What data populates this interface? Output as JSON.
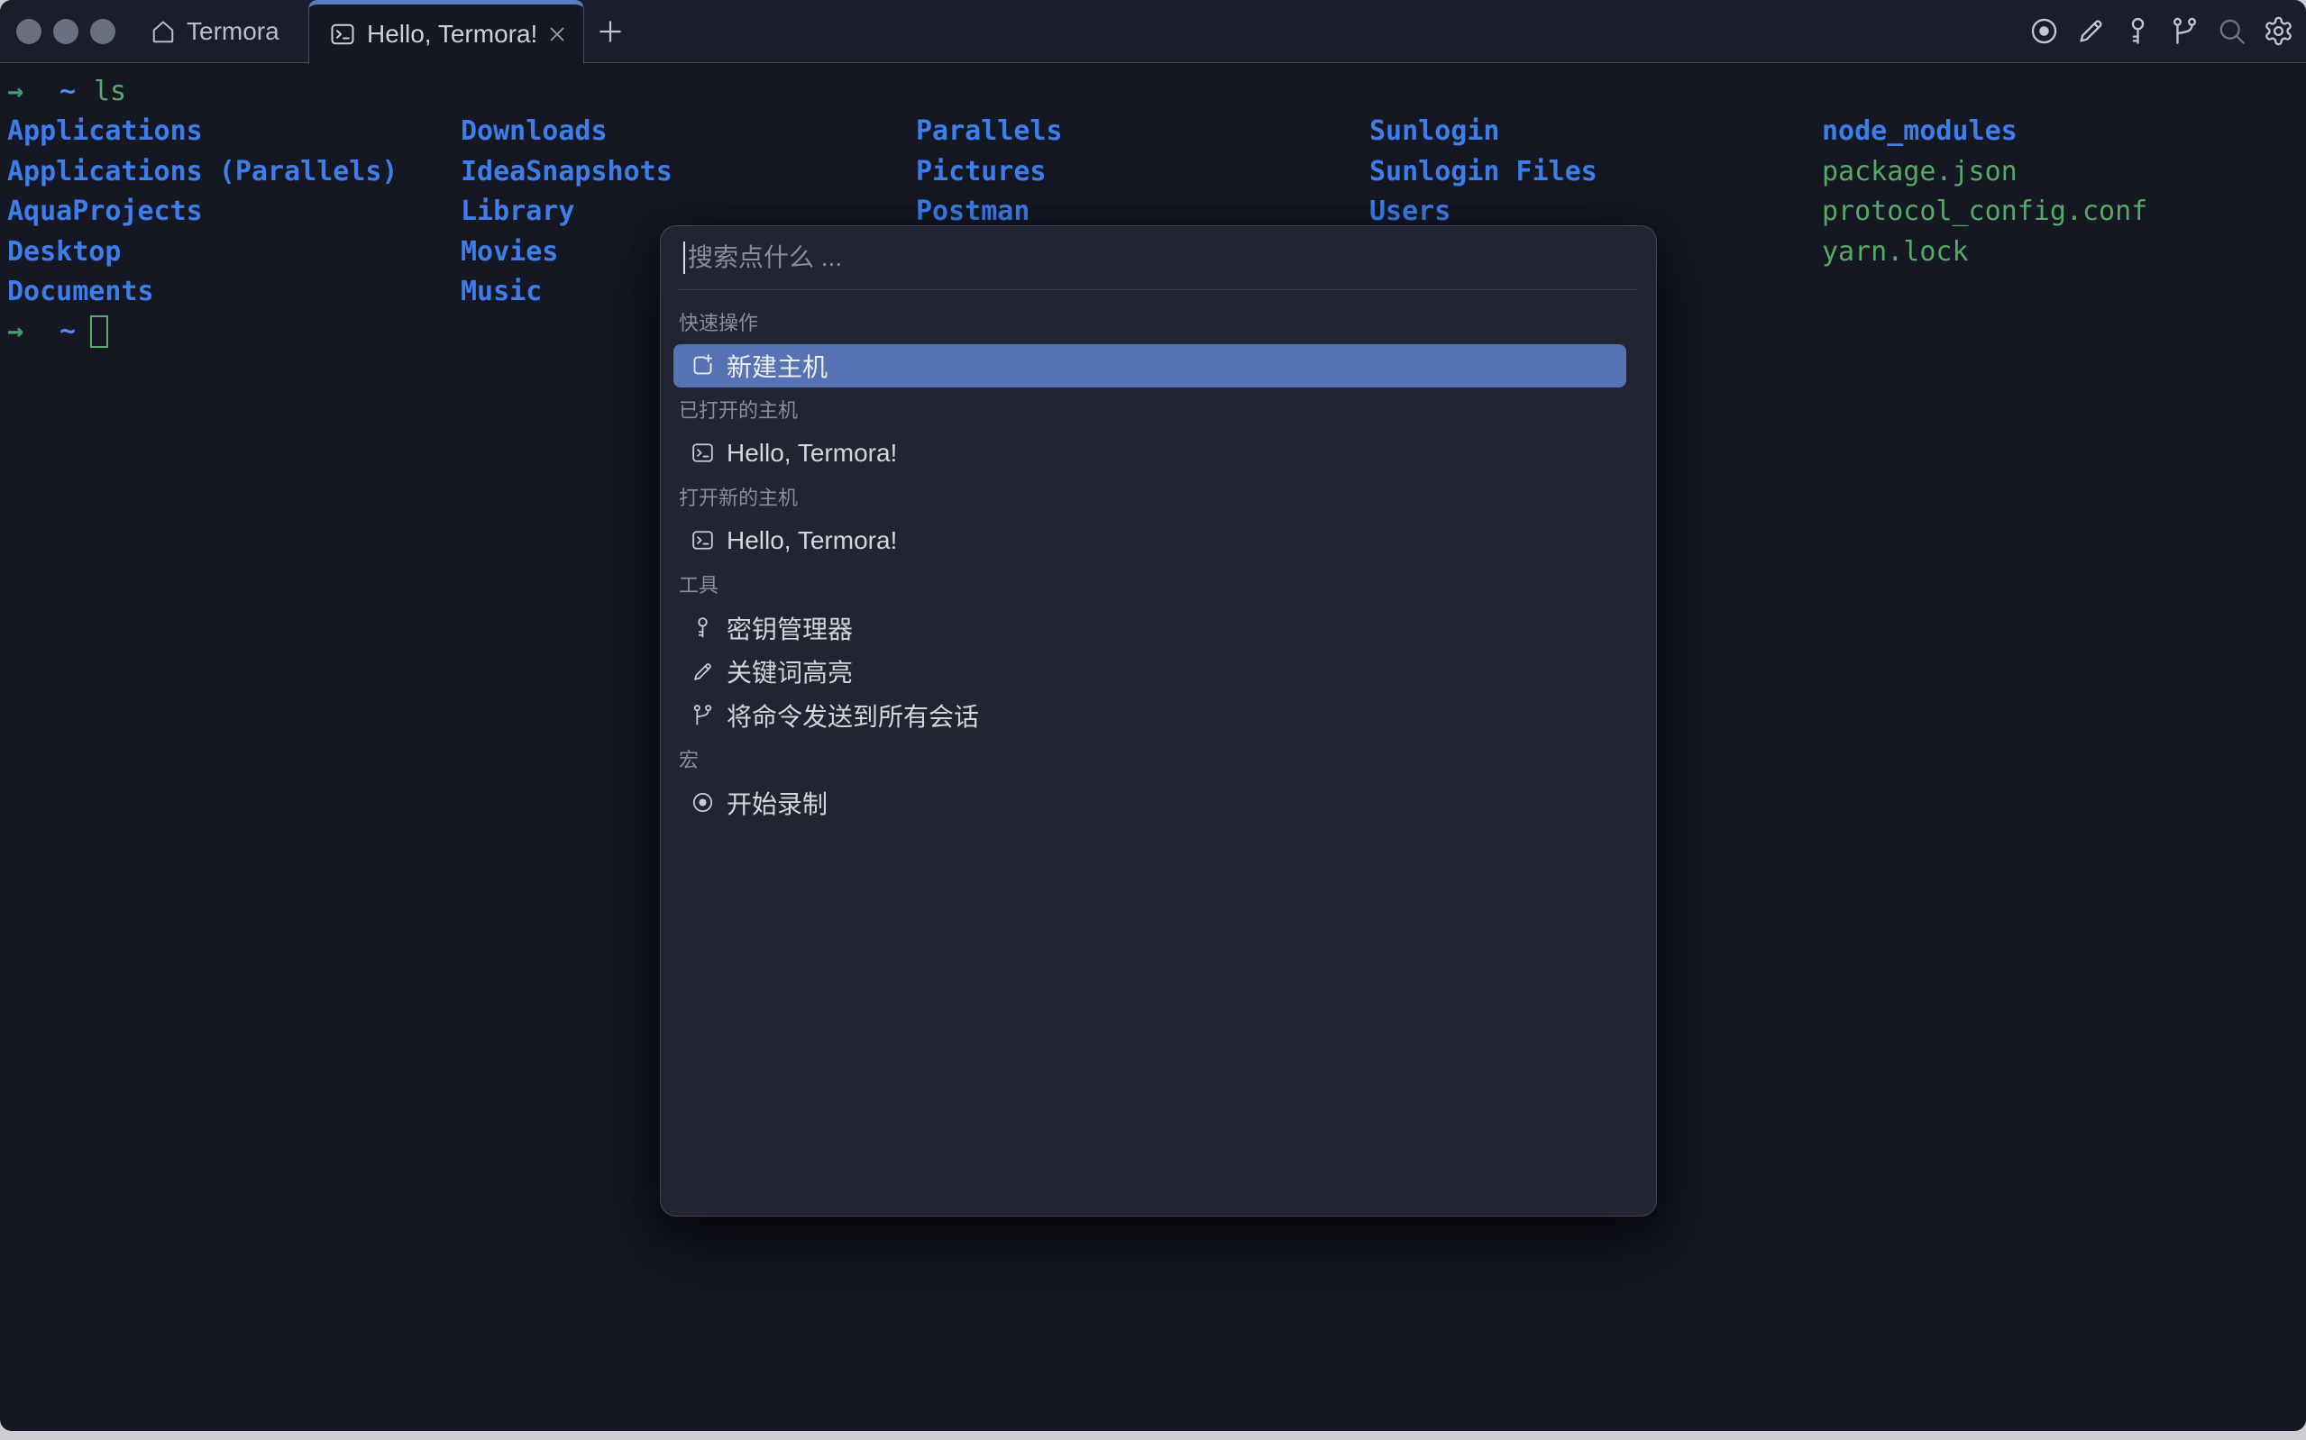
{
  "window": {
    "traffic_lights": [
      "close",
      "minimize",
      "zoom"
    ],
    "tab_bar": {
      "app_name": "Termora",
      "active_tab_label": "Hello, Termora!",
      "toolbar_icons": [
        {
          "name": "record"
        },
        {
          "name": "edit"
        },
        {
          "name": "key"
        },
        {
          "name": "branch"
        },
        {
          "name": "search",
          "dim": true
        },
        {
          "name": "settings"
        }
      ]
    }
  },
  "terminal": {
    "prompt_arrow": "→",
    "prompt_path": "~",
    "command": "ls",
    "colors": {
      "background": "#151823",
      "directory": "#3d7eea",
      "file": "#56a966",
      "arrow": "#459e72",
      "path": "#548af0",
      "command_text": "#5aa96d",
      "cursor": "#5aa96d"
    },
    "listing_columns": [
      {
        "entries": [
          {
            "name": "Applications",
            "kind": "dir"
          },
          {
            "name": "Applications (Parallels)",
            "kind": "dir"
          },
          {
            "name": "AquaProjects",
            "kind": "dir"
          },
          {
            "name": "Desktop",
            "kind": "dir"
          },
          {
            "name": "Documents",
            "kind": "dir"
          }
        ]
      },
      {
        "entries": [
          {
            "name": "Downloads",
            "kind": "dir"
          },
          {
            "name": "IdeaSnapshots",
            "kind": "dir"
          },
          {
            "name": "Library",
            "kind": "dir"
          },
          {
            "name": "Movies",
            "kind": "dir"
          },
          {
            "name": "Music",
            "kind": "dir"
          }
        ]
      },
      {
        "entries": [
          {
            "name": "Parallels",
            "kind": "dir"
          },
          {
            "name": "Pictures",
            "kind": "dir"
          },
          {
            "name": "Postman",
            "kind": "dir"
          }
        ]
      },
      {
        "entries": [
          {
            "name": "Sunlogin",
            "kind": "dir"
          },
          {
            "name": "Sunlogin Files",
            "kind": "dir"
          },
          {
            "name": "Users",
            "kind": "dir"
          }
        ]
      },
      {
        "entries": [
          {
            "name": "node_modules",
            "kind": "dir"
          },
          {
            "name": "package.json",
            "kind": "file"
          },
          {
            "name": "protocol_config.conf",
            "kind": "file"
          },
          {
            "name": "yarn.lock",
            "kind": "file"
          }
        ]
      }
    ]
  },
  "palette": {
    "search_placeholder": "搜索点什么 ...",
    "selection_color": "#5572b4",
    "sections": [
      {
        "label": "快速操作",
        "items": [
          {
            "icon": "new-host",
            "label": "新建主机",
            "selected": true
          }
        ]
      },
      {
        "label": "已打开的主机",
        "items": [
          {
            "icon": "terminal",
            "label": "Hello, Termora!"
          }
        ]
      },
      {
        "label": "打开新的主机",
        "items": [
          {
            "icon": "terminal",
            "label": "Hello, Termora!"
          }
        ]
      },
      {
        "label": "工具",
        "items": [
          {
            "icon": "key",
            "label": "密钥管理器"
          },
          {
            "icon": "highlighter",
            "label": "关键词高亮"
          },
          {
            "icon": "branch",
            "label": "将命令发送到所有会话"
          }
        ]
      },
      {
        "label": "宏",
        "items": [
          {
            "icon": "record",
            "label": "开始录制"
          }
        ]
      }
    ]
  }
}
